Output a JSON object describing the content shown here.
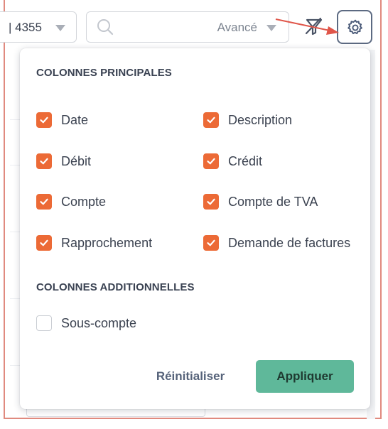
{
  "toolbar": {
    "account_value": "| 4355",
    "search_placeholder": "",
    "search_advanced_label": "Avancé",
    "filter_icon": "filter-clear-icon",
    "settings_icon": "gear-icon"
  },
  "popover": {
    "main_section_title": "COLONNES PRINCIPALES",
    "main_columns": [
      {
        "label": "Date",
        "checked": true
      },
      {
        "label": "Description",
        "checked": true
      },
      {
        "label": "Débit",
        "checked": true
      },
      {
        "label": "Crédit",
        "checked": true
      },
      {
        "label": "Compte",
        "checked": true
      },
      {
        "label": "Compte de TVA",
        "checked": true
      },
      {
        "label": "Rapprochement",
        "checked": true
      },
      {
        "label": "Demande de factures",
        "checked": true
      }
    ],
    "additional_section_title": "COLONNES ADDITIONNELLES",
    "additional_columns": [
      {
        "label": "Sous-compte",
        "checked": false
      }
    ],
    "reset_label": "Réinitialiser",
    "apply_label": "Appliquer"
  },
  "colors": {
    "accent_checkbox": "#ec6a36",
    "apply_button": "#5fb89a",
    "annotation": "#e0564a"
  }
}
